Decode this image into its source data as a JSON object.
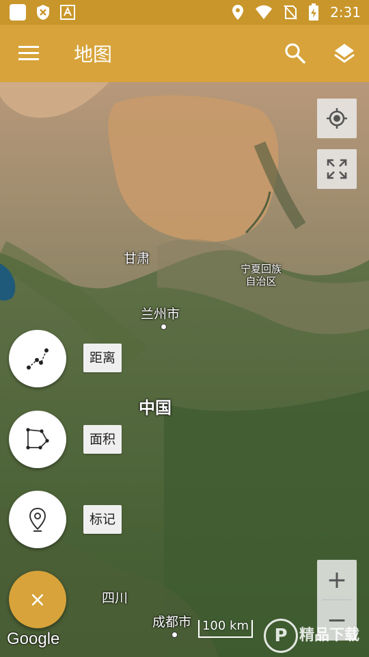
{
  "status_bar": {
    "time": "2:31",
    "left_icons": [
      "app-square-icon",
      "shield-icon",
      "translate-icon"
    ],
    "right_icons": [
      "location-icon",
      "wifi-icon",
      "no-sim-icon",
      "battery-charging-icon"
    ]
  },
  "app_bar": {
    "title": "地图",
    "icons": [
      "menu-icon",
      "search-icon",
      "layers-icon"
    ]
  },
  "map": {
    "labels": {
      "gansu": "甘肃",
      "ningxia_line1": "宁夏回族",
      "ningxia_line2": "自治区",
      "lanzhou": "兰州市",
      "china": "中国",
      "sichuan": "四川",
      "chengdu": "成都市"
    },
    "attribution": "Google",
    "scale": "100 km"
  },
  "tools": [
    {
      "icon": "distance-icon",
      "label": "距离"
    },
    {
      "icon": "area-icon",
      "label": "面积"
    },
    {
      "icon": "marker-icon",
      "label": "标记"
    }
  ],
  "controls": {
    "my_location_icon": "my-location-icon",
    "fullscreen_icon": "fullscreen-icon",
    "zoom_in": "+",
    "zoom_out": "−",
    "fab": "×"
  },
  "watermark": {
    "letter": "P",
    "text": "精品下载"
  },
  "colors": {
    "status_bar": "#c8962a",
    "app_bar": "#d7a33a",
    "fab": "#d7a33a"
  }
}
